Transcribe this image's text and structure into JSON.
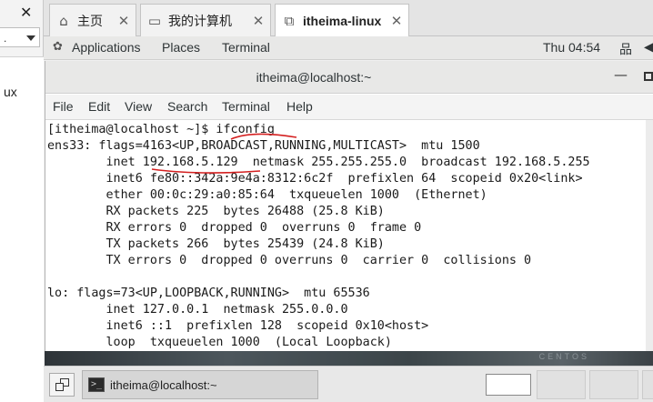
{
  "left_panel": {
    "close_glyph": "✕",
    "dropdown_value": ".",
    "list_item": "ux"
  },
  "vm_tabs": [
    {
      "label": "主页",
      "icon": "home-icon",
      "close": "✕"
    },
    {
      "label": "我的计算机",
      "icon": "computer-icon",
      "close": "✕"
    },
    {
      "label": "itheima-linux",
      "icon": "vm-icon",
      "close": "✕"
    }
  ],
  "gnome_bar": {
    "applications": "Applications",
    "places": "Places",
    "terminal": "Terminal",
    "clock": "Thu 04:54",
    "network_icon": "network-icon",
    "volume_icon": "volume-icon"
  },
  "terminal_window": {
    "title": "itheima@localhost:~",
    "minimize_glyph": "—",
    "menu": [
      "File",
      "Edit",
      "View",
      "Search",
      "Terminal",
      "Help"
    ]
  },
  "terminal_lines": [
    "[itheima@localhost ~]$ ifconfig",
    "ens33: flags=4163<UP,BROADCAST,RUNNING,MULTICAST>  mtu 1500",
    "        inet 192.168.5.129  netmask 255.255.255.0  broadcast 192.168.5.255",
    "        inet6 fe80::342a:9e4a:8312:6c2f  prefixlen 64  scopeid 0x20<link>",
    "        ether 00:0c:29:a0:85:64  txqueuelen 1000  (Ethernet)",
    "        RX packets 225  bytes 26488 (25.8 KiB)",
    "        RX errors 0  dropped 0  overruns 0  frame 0",
    "        TX packets 266  bytes 25439 (24.8 KiB)",
    "        TX errors 0  dropped 0 overruns 0  carrier 0  collisions 0",
    "",
    "lo: flags=73<UP,LOOPBACK,RUNNING>  mtu 65536",
    "        inet 127.0.0.1  netmask 255.0.0.0",
    "        inet6 ::1  prefixlen 128  scopeid 0x10<host>",
    "        loop  txqueuelen 1000  (Local Loopback)"
  ],
  "desktop": {
    "brand_mark": "CENTOS"
  },
  "taskbar": {
    "task_label": "itheima@localhost:~",
    "task_icon": "terminal-icon"
  },
  "colors": {
    "annotation": "#d42020",
    "terminal_bg": "#ffffff",
    "terminal_fg": "#1a1a1a"
  }
}
